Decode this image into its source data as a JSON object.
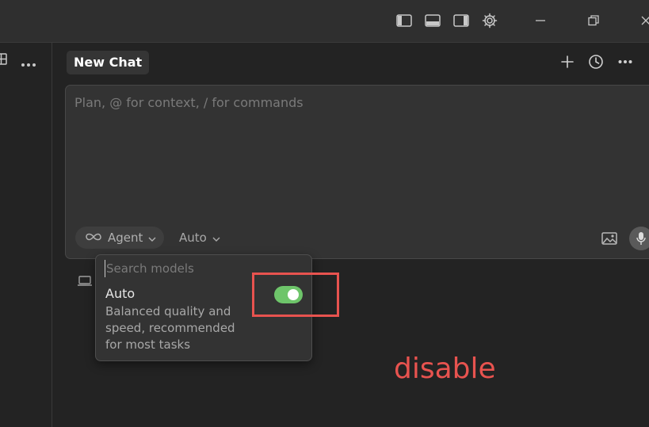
{
  "chat": {
    "tab_title": "New Chat",
    "prompt_placeholder": "Plan, @ for context, / for commands"
  },
  "composer": {
    "mode_label": "Agent",
    "model_label": "Auto"
  },
  "model_dropdown": {
    "search_placeholder": "Search models",
    "items": [
      {
        "name": "Auto",
        "description": "Balanced quality and speed, recommended for most tasks",
        "toggle_on": true
      }
    ]
  },
  "annotation": {
    "text": "disable",
    "color": "#e8534f"
  },
  "colors": {
    "toggle_on": "#6ec56a",
    "background": "#232323",
    "titlebar": "#2f2f2f",
    "composer": "#333333"
  },
  "icons": [
    "toggle-sidebar-icon",
    "toggle-panel-icon",
    "toggle-secondary-sidebar-icon",
    "gear-icon",
    "minimize-icon",
    "restore-icon",
    "close-icon",
    "layout-icon",
    "more-icon",
    "plus-icon",
    "history-icon",
    "infinity-icon",
    "chevron-down-icon",
    "image-icon",
    "microphone-icon",
    "laptop-icon"
  ]
}
